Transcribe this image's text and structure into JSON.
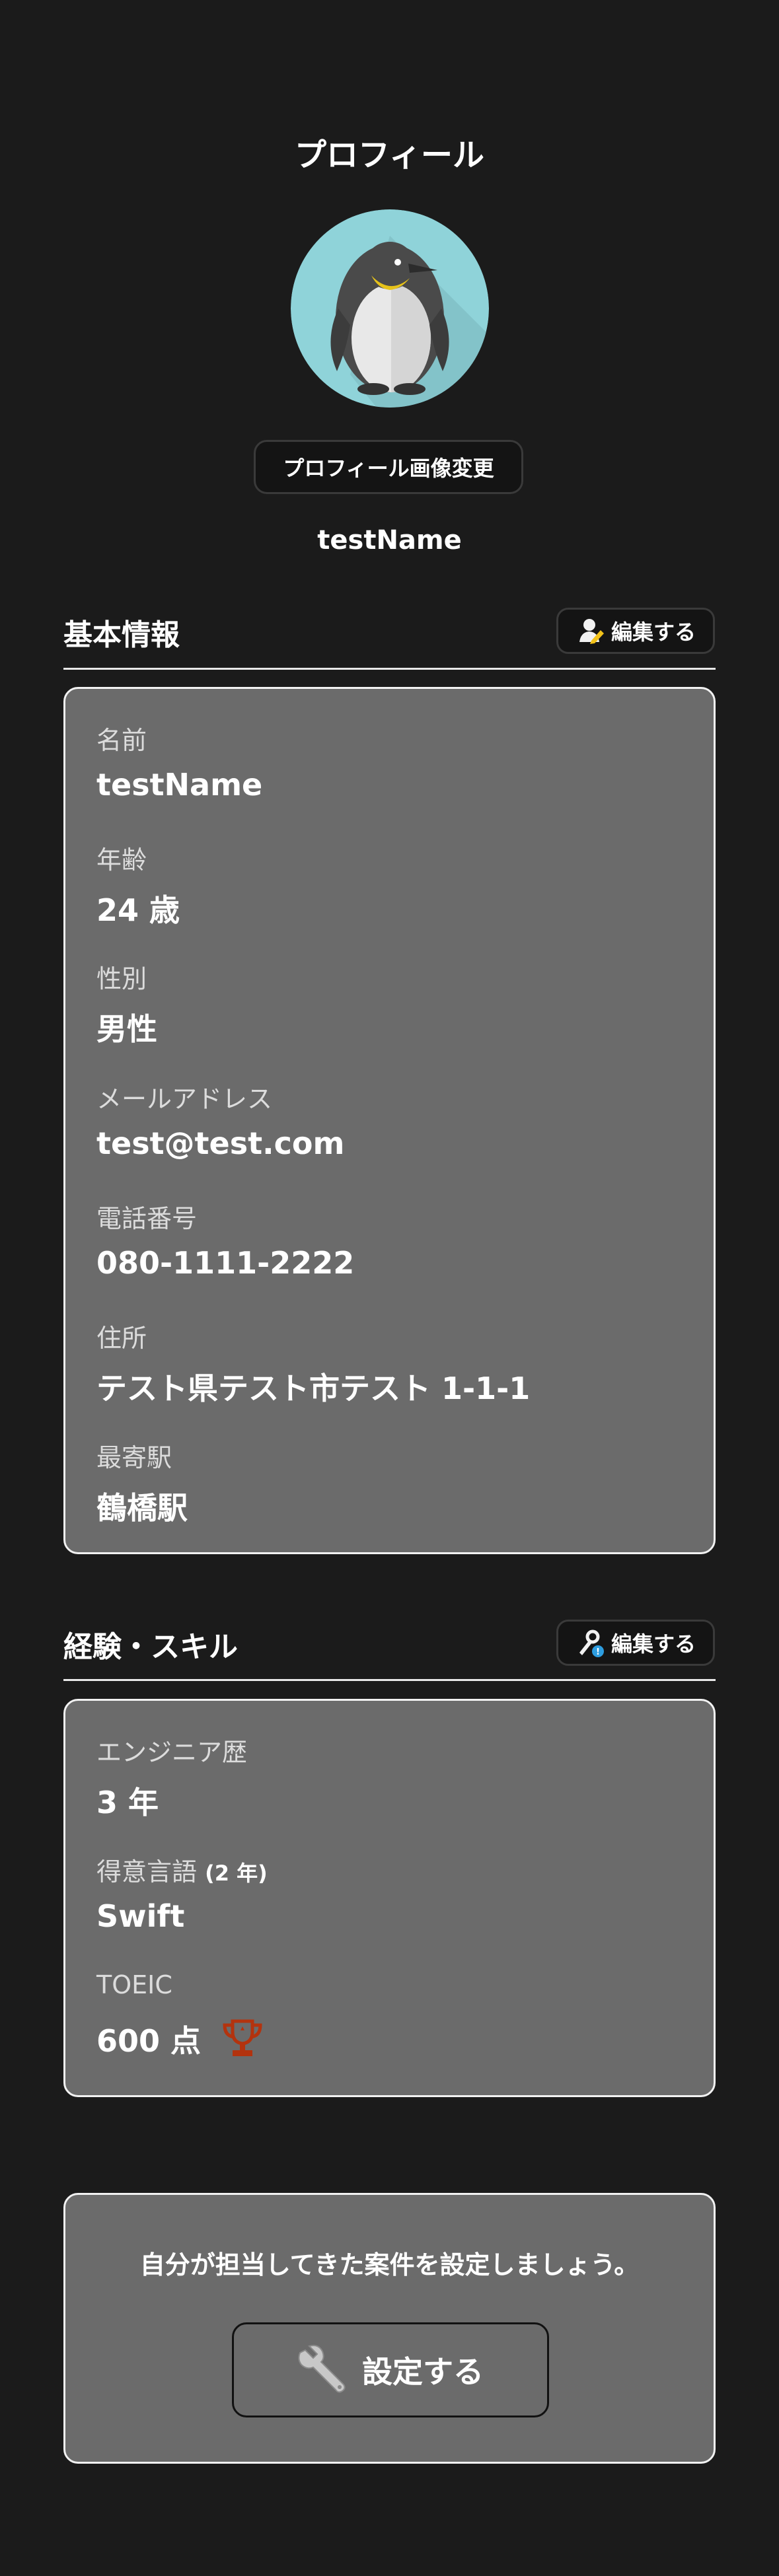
{
  "header": {
    "title": "プロフィール"
  },
  "profile": {
    "change_image_label": "プロフィール画像変更",
    "username": "testName",
    "avatar_icon": "penguin-icon"
  },
  "basic_info": {
    "title": "基本情報",
    "edit_label": "編集する",
    "fields": [
      {
        "label": "名前",
        "value": "testName"
      },
      {
        "label": "年齢",
        "value": "24 歳"
      },
      {
        "label": "性別",
        "value": "男性"
      },
      {
        "label": "メールアドレス",
        "value": "test@test.com"
      },
      {
        "label": "電話番号",
        "value": "080-1111-2222"
      },
      {
        "label": "住所",
        "value": "テスト県テスト市テスト 1-1-1"
      },
      {
        "label": "最寄駅",
        "value": "鶴橋駅"
      }
    ]
  },
  "skills": {
    "title": "経験・スキル",
    "edit_label": "編集する",
    "fields": [
      {
        "label": "エンジニア歴",
        "value": "3 年"
      },
      {
        "label": "得意言語",
        "sub": "(2 年)",
        "value": "Swift"
      },
      {
        "label": "TOEIC",
        "value": "600 点",
        "badge_icon": "trophy-icon"
      }
    ]
  },
  "projects": {
    "prompt": "自分が担当してきた案件を設定しましょう。",
    "button_label": "設定する",
    "button_icon": "wrench-icon"
  },
  "colors": {
    "background": "#1b1b1b",
    "card": "#6b6b6b",
    "avatar_bg": "#8fd3d9",
    "trophy": "#b3330e"
  }
}
